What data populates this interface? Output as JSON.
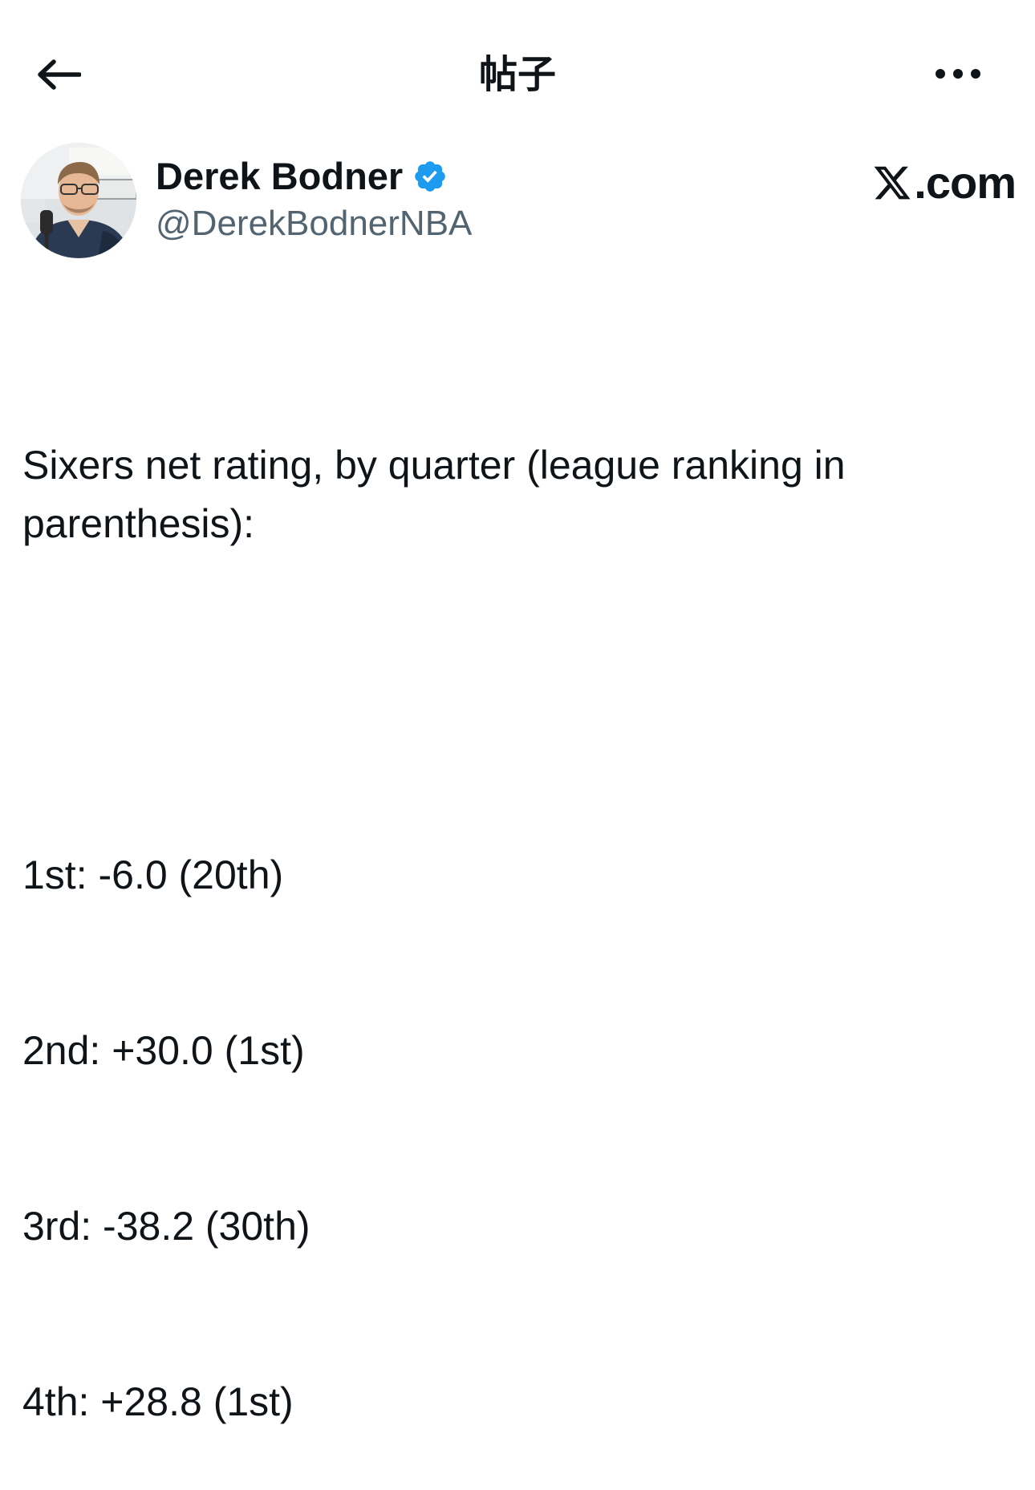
{
  "header": {
    "title": "帖子",
    "back_icon": "arrow-left-icon",
    "more_icon": "more-horizontal-icon"
  },
  "author": {
    "display_name": "Derek Bodner",
    "handle": "@DerekBodnerNBA",
    "verified": true,
    "verified_color": "#1d9bf0",
    "avatar_icon": "profile-photo"
  },
  "watermark": {
    "label": ".com",
    "logo_icon": "x-logo-icon"
  },
  "tweet": {
    "intro": "Sixers net rating, by quarter (league ranking in parenthesis):",
    "lines": [
      "1st: -6.0 (20th)",
      "2nd: +30.0 (1st)",
      "3rd: -38.2 (30th)",
      "4th: +28.8 (1st)"
    ]
  },
  "colors": {
    "text_primary": "#0f1419",
    "text_secondary": "#536471",
    "background": "#ffffff"
  }
}
